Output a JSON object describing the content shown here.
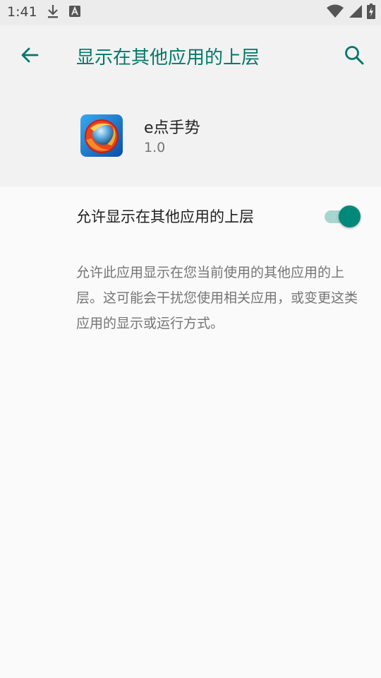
{
  "status_bar": {
    "time": "1:41",
    "left_icons": [
      "download-icon",
      "a-notification-icon"
    ],
    "right_icons": [
      "wifi-icon",
      "cellular-signal-icon",
      "battery-charging-icon"
    ]
  },
  "app_bar": {
    "title": "显示在其他应用的上层",
    "back_icon": "arrow-left-icon",
    "search_icon": "search-icon"
  },
  "app": {
    "name": "e点手势",
    "version": "1.0",
    "icon": "app-logo-icon"
  },
  "permission": {
    "switch_label": "允许显示在其他应用的上层",
    "enabled": true,
    "description": "允许此应用显示在您当前使用的其他应用的上层。这可能会干扰您使用相关应用，或变更这类应用的显示或运行方式。"
  },
  "colors": {
    "accent": "#00796b",
    "switch_thumb": "#00897b",
    "switch_track": "#a8d5cf",
    "header_bg": "#f2f2f2",
    "page_bg": "#fafafa"
  }
}
